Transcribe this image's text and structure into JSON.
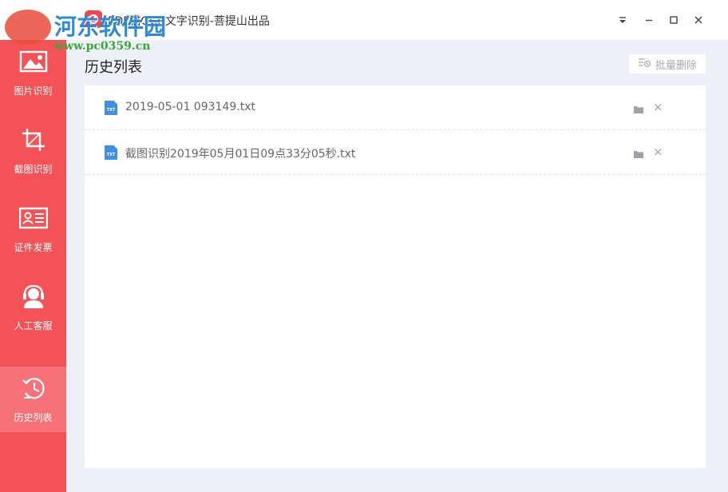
{
  "window": {
    "title": "PDF猫OCR文字识别-菩提山出品"
  },
  "watermark": {
    "name": "河东软件园",
    "url": "www.pc0359.cn"
  },
  "sidebar": {
    "items": [
      {
        "label": "图片识别",
        "icon": "image-icon",
        "active": false
      },
      {
        "label": "截图识别",
        "icon": "crop-icon",
        "active": false
      },
      {
        "label": "证件发票",
        "icon": "id-card-icon",
        "active": false
      },
      {
        "label": "人工客服",
        "icon": "customer-service-icon",
        "active": false
      },
      {
        "label": "历史列表",
        "icon": "history-icon",
        "active": true
      }
    ]
  },
  "main": {
    "title": "历史列表",
    "batch_delete_label": "批量删除",
    "files": [
      {
        "icon_text": "TXT",
        "name": "2019-05-01  093149.txt"
      },
      {
        "icon_text": "TXT",
        "name": "截图识别2019年05月01日09点33分05秒.txt"
      }
    ]
  },
  "colors": {
    "sidebar": "#f35257",
    "sidebar_active": "#f77278",
    "background": "#eef0f7",
    "file_icon": "#3f8fe3"
  }
}
